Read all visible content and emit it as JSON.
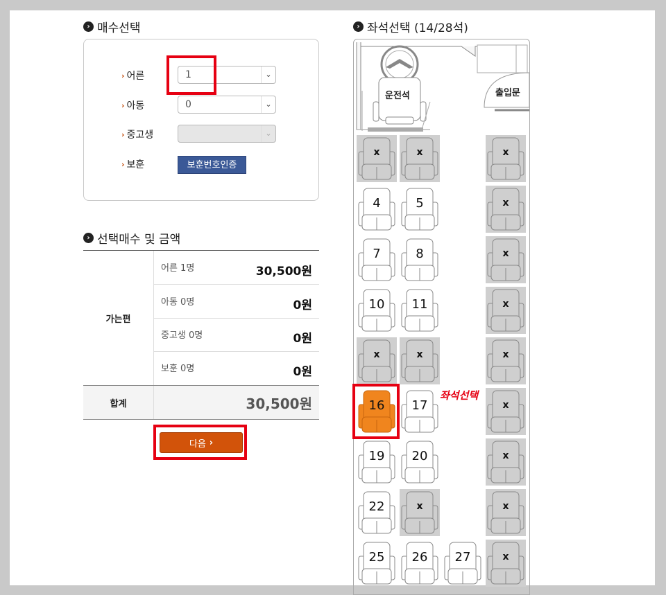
{
  "ticket_section": {
    "title": "매수선택",
    "rows": [
      {
        "label": "어른",
        "value": "1"
      },
      {
        "label": "아동",
        "value": "0"
      },
      {
        "label": "중고생",
        "value": ""
      },
      {
        "label": "보훈",
        "button": "보훈번호인증"
      }
    ]
  },
  "summary_section": {
    "title": "선택매수 및 금액",
    "direction_label": "가는편",
    "rows": [
      {
        "label": "어른 1명",
        "amount": "30,500원"
      },
      {
        "label": "아동 0명",
        "amount": "0원"
      },
      {
        "label": "중고생 0명",
        "amount": "0원"
      },
      {
        "label": "보훈 0명",
        "amount": "0원"
      }
    ],
    "total_label": "합계",
    "total_amount": "30,500원"
  },
  "next_button": {
    "label": "다음",
    "icon": "chevron-right-icon"
  },
  "seat_section": {
    "title": "좌석선택 (14/28석)",
    "driver_label": "운전석",
    "door_label": "출입문",
    "taken_mark": "x",
    "selected_note": "좌석선택",
    "seats": [
      {
        "label": "x",
        "status": "taken"
      },
      {
        "label": "x",
        "status": "taken"
      },
      {
        "label": "x",
        "status": "taken"
      },
      {
        "label": "4",
        "status": "available"
      },
      {
        "label": "5",
        "status": "available"
      },
      {
        "label": "x",
        "status": "taken"
      },
      {
        "label": "7",
        "status": "available"
      },
      {
        "label": "8",
        "status": "available"
      },
      {
        "label": "x",
        "status": "taken"
      },
      {
        "label": "10",
        "status": "available"
      },
      {
        "label": "11",
        "status": "available"
      },
      {
        "label": "x",
        "status": "taken"
      },
      {
        "label": "x",
        "status": "taken"
      },
      {
        "label": "x",
        "status": "taken"
      },
      {
        "label": "x",
        "status": "taken"
      },
      {
        "label": "16",
        "status": "selected"
      },
      {
        "label": "17",
        "status": "available"
      },
      {
        "label": "x",
        "status": "taken"
      },
      {
        "label": "19",
        "status": "available"
      },
      {
        "label": "20",
        "status": "available"
      },
      {
        "label": "x",
        "status": "taken"
      },
      {
        "label": "22",
        "status": "available"
      },
      {
        "label": "x",
        "status": "taken"
      },
      {
        "label": "x",
        "status": "taken"
      },
      {
        "label": "25",
        "status": "available"
      },
      {
        "label": "26",
        "status": "available"
      },
      {
        "label": "27",
        "status": "available"
      },
      {
        "label": "x",
        "status": "taken"
      }
    ]
  },
  "colors": {
    "selected": "#f0851e",
    "taken": "#cfcfcf",
    "available": "#ffffff",
    "accent": "#d2530a",
    "highlight": "#e60012"
  }
}
